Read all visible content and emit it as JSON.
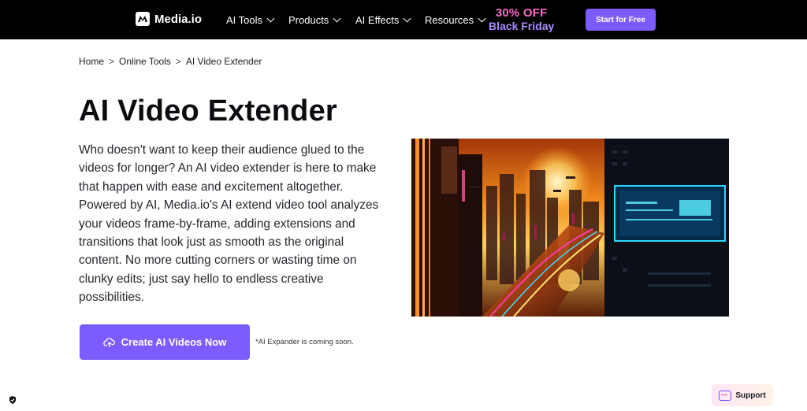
{
  "nav": {
    "brand": "Media.io",
    "items": [
      {
        "label": "AI Tools"
      },
      {
        "label": "Products"
      },
      {
        "label": "AI Effects"
      },
      {
        "label": "Resources"
      }
    ],
    "promo_line1": "30% OFF",
    "promo_line2": "Black Friday",
    "cta_label": "Start for Free"
  },
  "breadcrumb": {
    "items": [
      "Home",
      "Online Tools",
      "AI Video Extender"
    ],
    "separator": ">"
  },
  "main": {
    "title": "AI Video Extender",
    "description": "Who doesn't want to keep their audience glued to the videos for longer? An AI video extender is here to make that happen with ease and excitement altogether. Powered by AI, Media.io's AI extend video tool analyzes your videos frame-by-frame, adding extensions and transitions that look just as smooth as the original content. No more cutting corners or wasting time on clunky edits; just say hello to endless creative possibilities.",
    "cta_label": "Create AI Videos Now",
    "note": "*AI Expander is coming soon."
  },
  "support": {
    "label": "Support"
  },
  "colors": {
    "accent": "#7b5cff",
    "nav_bg": "#000000",
    "promo_pink": "#f46ec8"
  },
  "icons": {
    "cta": "cloud-upload-icon",
    "support": "chat-icon",
    "security": "shield-check-icon"
  }
}
